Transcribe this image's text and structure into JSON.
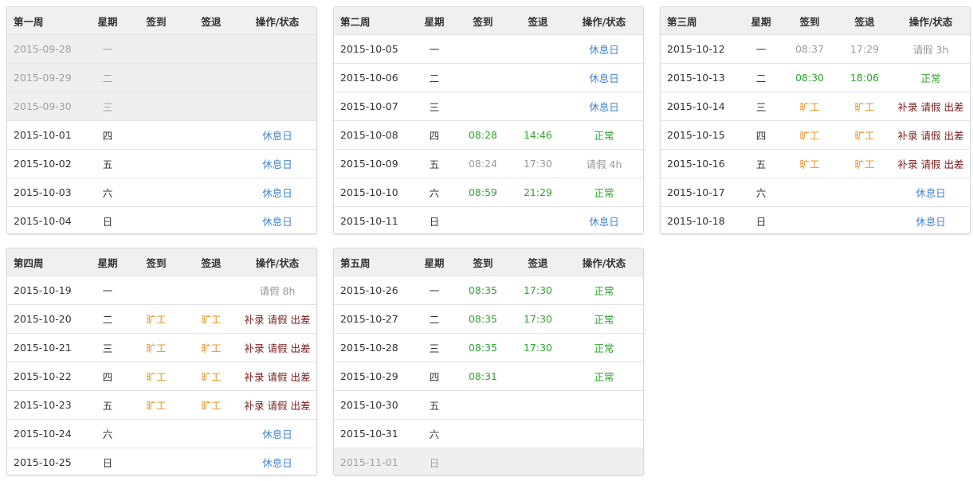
{
  "columns": [
    "星期",
    "签到",
    "签退",
    "操作/状态"
  ],
  "weeks": [
    {
      "title": "第一周",
      "rows": [
        {
          "date": "2015-09-28",
          "day": "一",
          "in": "",
          "out": "",
          "status": "",
          "inactive": true
        },
        {
          "date": "2015-09-29",
          "day": "二",
          "in": "",
          "out": "",
          "status": "",
          "inactive": true
        },
        {
          "date": "2015-09-30",
          "day": "三",
          "in": "",
          "out": "",
          "status": "",
          "inactive": true
        },
        {
          "date": "2015-10-01",
          "day": "四",
          "in": "",
          "out": "",
          "status": "休息日",
          "status_type": "blue"
        },
        {
          "date": "2015-10-02",
          "day": "五",
          "in": "",
          "out": "",
          "status": "休息日",
          "status_type": "blue"
        },
        {
          "date": "2015-10-03",
          "day": "六",
          "in": "",
          "out": "",
          "status": "休息日",
          "status_type": "blue"
        },
        {
          "date": "2015-10-04",
          "day": "日",
          "in": "",
          "out": "",
          "status": "休息日",
          "status_type": "blue"
        }
      ]
    },
    {
      "title": "第二周",
      "rows": [
        {
          "date": "2015-10-05",
          "day": "一",
          "in": "",
          "out": "",
          "status": "休息日",
          "status_type": "blue"
        },
        {
          "date": "2015-10-06",
          "day": "二",
          "in": "",
          "out": "",
          "status": "休息日",
          "status_type": "blue"
        },
        {
          "date": "2015-10-07",
          "day": "三",
          "in": "",
          "out": "",
          "status": "休息日",
          "status_type": "blue"
        },
        {
          "date": "2015-10-08",
          "day": "四",
          "in": "08:28",
          "out": "14:46",
          "time_type": "green",
          "status": "正常",
          "status_type": "green"
        },
        {
          "date": "2015-10-09",
          "day": "五",
          "in": "08:24",
          "out": "17:30",
          "time_type": "gray",
          "status": "请假 4h",
          "status_type": "gray"
        },
        {
          "date": "2015-10-10",
          "day": "六",
          "in": "08:59",
          "out": "21:29",
          "time_type": "green",
          "status": "正常",
          "status_type": "green"
        },
        {
          "date": "2015-10-11",
          "day": "日",
          "in": "",
          "out": "",
          "status": "休息日",
          "status_type": "blue"
        }
      ]
    },
    {
      "title": "第三周",
      "rows": [
        {
          "date": "2015-10-12",
          "day": "一",
          "in": "08:37",
          "out": "17:29",
          "time_type": "gray",
          "status": "请假 3h",
          "status_type": "gray"
        },
        {
          "date": "2015-10-13",
          "day": "二",
          "in": "08:30",
          "out": "18:06",
          "time_type": "green",
          "status": "正常",
          "status_type": "green"
        },
        {
          "date": "2015-10-14",
          "day": "三",
          "in": "旷工",
          "out": "旷工",
          "time_type": "orange",
          "actions": [
            "补录",
            "请假",
            "出差"
          ]
        },
        {
          "date": "2015-10-15",
          "day": "四",
          "in": "旷工",
          "out": "旷工",
          "time_type": "orange",
          "actions": [
            "补录",
            "请假",
            "出差"
          ]
        },
        {
          "date": "2015-10-16",
          "day": "五",
          "in": "旷工",
          "out": "旷工",
          "time_type": "orange",
          "actions": [
            "补录",
            "请假",
            "出差"
          ]
        },
        {
          "date": "2015-10-17",
          "day": "六",
          "in": "",
          "out": "",
          "status": "休息日",
          "status_type": "blue"
        },
        {
          "date": "2015-10-18",
          "day": "日",
          "in": "",
          "out": "",
          "status": "休息日",
          "status_type": "blue"
        }
      ]
    },
    {
      "title": "第四周",
      "rows": [
        {
          "date": "2015-10-19",
          "day": "一",
          "in": "",
          "out": "",
          "status": "请假 8h",
          "status_type": "gray"
        },
        {
          "date": "2015-10-20",
          "day": "二",
          "in": "旷工",
          "out": "旷工",
          "time_type": "orange",
          "actions": [
            "补录",
            "请假",
            "出差"
          ]
        },
        {
          "date": "2015-10-21",
          "day": "三",
          "in": "旷工",
          "out": "旷工",
          "time_type": "orange",
          "actions": [
            "补录",
            "请假",
            "出差"
          ]
        },
        {
          "date": "2015-10-22",
          "day": "四",
          "in": "旷工",
          "out": "旷工",
          "time_type": "orange",
          "actions": [
            "补录",
            "请假",
            "出差"
          ]
        },
        {
          "date": "2015-10-23",
          "day": "五",
          "in": "旷工",
          "out": "旷工",
          "time_type": "orange",
          "actions": [
            "补录",
            "请假",
            "出差"
          ]
        },
        {
          "date": "2015-10-24",
          "day": "六",
          "in": "",
          "out": "",
          "status": "休息日",
          "status_type": "blue"
        },
        {
          "date": "2015-10-25",
          "day": "日",
          "in": "",
          "out": "",
          "status": "休息日",
          "status_type": "blue"
        }
      ]
    },
    {
      "title": "第五周",
      "rows": [
        {
          "date": "2015-10-26",
          "day": "一",
          "in": "08:35",
          "out": "17:30",
          "time_type": "green",
          "status": "正常",
          "status_type": "green"
        },
        {
          "date": "2015-10-27",
          "day": "二",
          "in": "08:35",
          "out": "17:30",
          "time_type": "green",
          "status": "正常",
          "status_type": "green"
        },
        {
          "date": "2015-10-28",
          "day": "三",
          "in": "08:35",
          "out": "17:30",
          "time_type": "green",
          "status": "正常",
          "status_type": "green"
        },
        {
          "date": "2015-10-29",
          "day": "四",
          "in": "08:31",
          "out": "",
          "time_type": "green",
          "status": "正常",
          "status_type": "green"
        },
        {
          "date": "2015-10-30",
          "day": "五",
          "in": "",
          "out": "",
          "status": ""
        },
        {
          "date": "2015-10-31",
          "day": "六",
          "in": "",
          "out": "",
          "status": ""
        },
        {
          "date": "2015-11-01",
          "day": "日",
          "in": "",
          "out": "",
          "status": "",
          "inactive": true
        }
      ]
    }
  ],
  "colors": {
    "normal": "#2ea52e",
    "absent": "#e4962a",
    "rest_day": "#3f82d0",
    "leave": "#999999",
    "action": "#7b1d1d",
    "inactive_bg": "#efefef",
    "header_bg": "#f0f0f0"
  }
}
